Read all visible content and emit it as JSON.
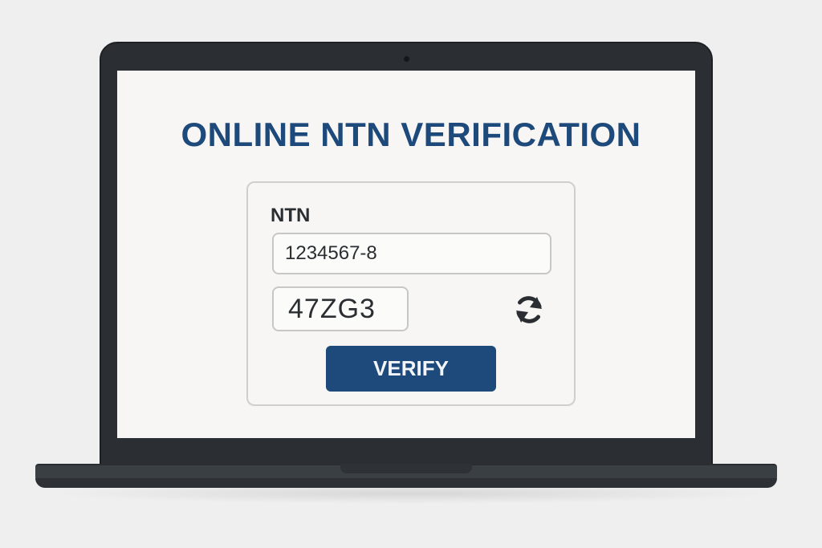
{
  "page": {
    "title": "ONLINE NTN VERIFICATION"
  },
  "form": {
    "ntn_label": "NTN",
    "ntn_value": "1234567-8",
    "captcha_text": "47ZG3",
    "refresh_icon": "refresh-icon",
    "verify_label": "VERIFY"
  },
  "colors": {
    "brand": "#1d4a7b",
    "laptop_body": "#2b2f33",
    "screen_bg": "#f7f6f4",
    "background": "#efefef"
  }
}
